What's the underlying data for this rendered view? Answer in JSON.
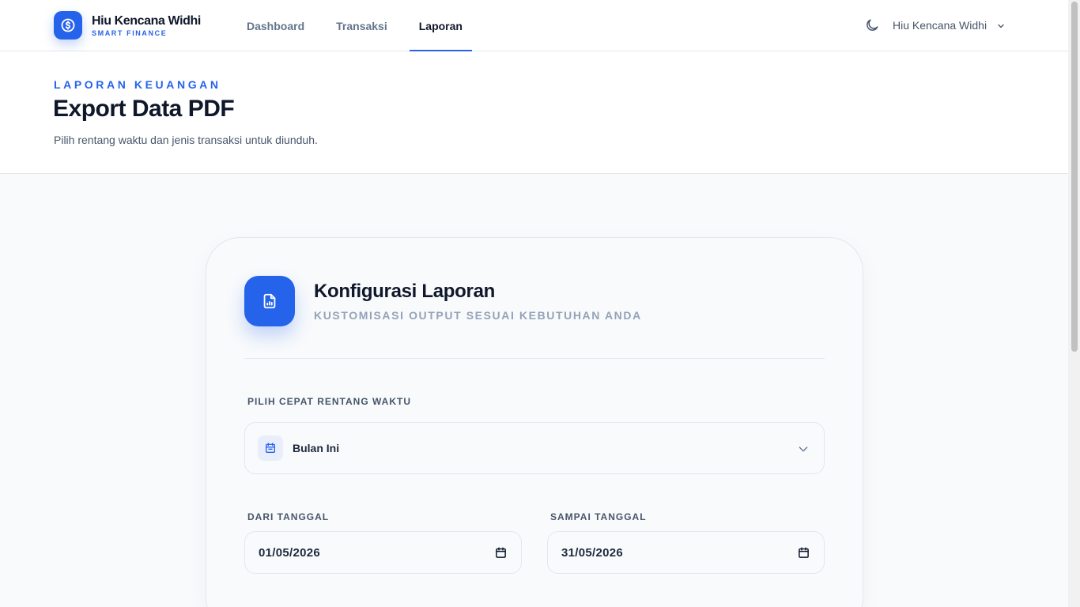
{
  "brand": {
    "name": "Hiu Kencana Widhi",
    "tagline": "SMART FINANCE",
    "accent": "#2563eb"
  },
  "nav": {
    "items": [
      {
        "label": "Dashboard",
        "active": false
      },
      {
        "label": "Transaksi",
        "active": false
      },
      {
        "label": "Laporan",
        "active": true
      }
    ]
  },
  "header": {
    "theme_icon": "moon-icon",
    "user_name": "Hiu Kencana Widhi"
  },
  "page": {
    "eyebrow": "LAPORAN KEUANGAN",
    "title": "Export Data PDF",
    "description": "Pilih rentang waktu dan jenis transaksi untuk diunduh."
  },
  "card": {
    "icon": "file-chart-icon",
    "title": "Konfigurasi Laporan",
    "subtitle": "KUSTOMISASI OUTPUT SESUAI KEBUTUHAN ANDA",
    "quick_range": {
      "label": "PILIH CEPAT RENTANG WAKTU",
      "value": "Bulan Ini"
    },
    "from_date": {
      "label": "DARI TANGGAL",
      "value": "01/05/2026"
    },
    "to_date": {
      "label": "SAMPAI TANGGAL",
      "value": "31/05/2026"
    }
  }
}
